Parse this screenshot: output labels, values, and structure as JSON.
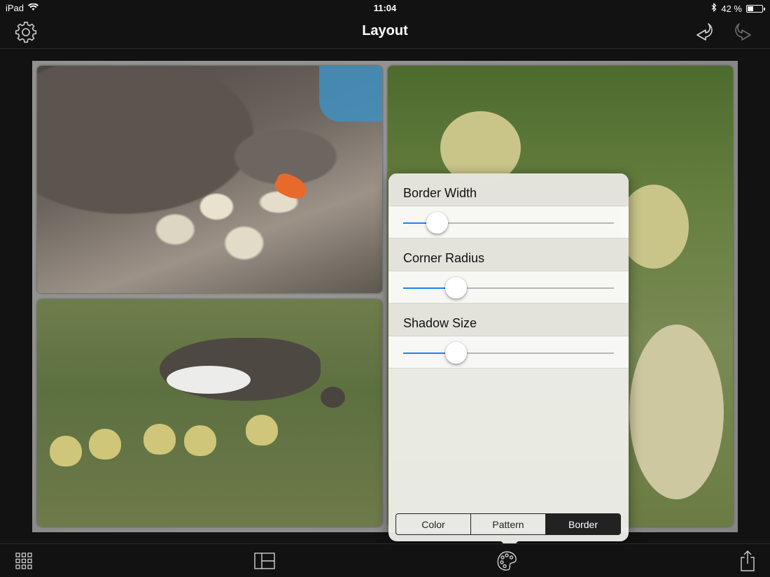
{
  "status_bar": {
    "device": "iPad",
    "time": "11:04",
    "battery": "42 %",
    "battery_level": 0.42
  },
  "nav": {
    "title": "Layout",
    "left_icon": "gear-icon",
    "right_icons": [
      "undo-icon",
      "redo-icon"
    ]
  },
  "popover": {
    "sliders": [
      {
        "label": "Border Width",
        "value": 0.16
      },
      {
        "label": "Corner Radius",
        "value": 0.25
      },
      {
        "label": "Shadow Size",
        "value": 0.25
      }
    ],
    "tabs": [
      {
        "label": "Color",
        "active": false
      },
      {
        "label": "Pattern",
        "active": false
      },
      {
        "label": "Border",
        "active": true
      }
    ]
  },
  "toolbar": {
    "icons": [
      "grid-icon",
      "layout-icon",
      "palette-icon",
      "share-icon"
    ]
  },
  "colors": {
    "accent": "#1a82f7",
    "background": "#121212",
    "popover": "#f0f0ec"
  }
}
